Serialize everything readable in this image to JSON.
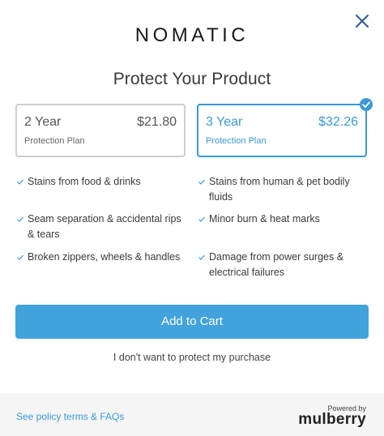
{
  "header": {
    "logo_text": "NOMATIC",
    "close_icon": "close-x-icon",
    "title": "Protect Your Product"
  },
  "plans": [
    {
      "years": "2 Year",
      "price": "$21.80",
      "subtitle": "Protection Plan",
      "selected": false
    },
    {
      "years": "3 Year",
      "price": "$32.26",
      "subtitle": "Protection Plan",
      "selected": true
    }
  ],
  "features": {
    "left": [
      "Stains from food & drinks",
      "Seam separation & accidental rips & tears",
      "Broken zippers, wheels & handles"
    ],
    "right": [
      "Stains from human & pet bodily fluids",
      "Minor burn & heat marks",
      "Damage from power surges & electrical failures"
    ]
  },
  "actions": {
    "add_to_cart": "Add to Cart",
    "decline": "I don't want to protect my purchase"
  },
  "footer": {
    "policy_link": "See policy terms & FAQs",
    "powered_by": "Powered by",
    "brand": "mulberry"
  },
  "colors": {
    "accent": "#3a9ad6",
    "button": "#42a2dc",
    "footer_bg": "#f5f5f5"
  }
}
